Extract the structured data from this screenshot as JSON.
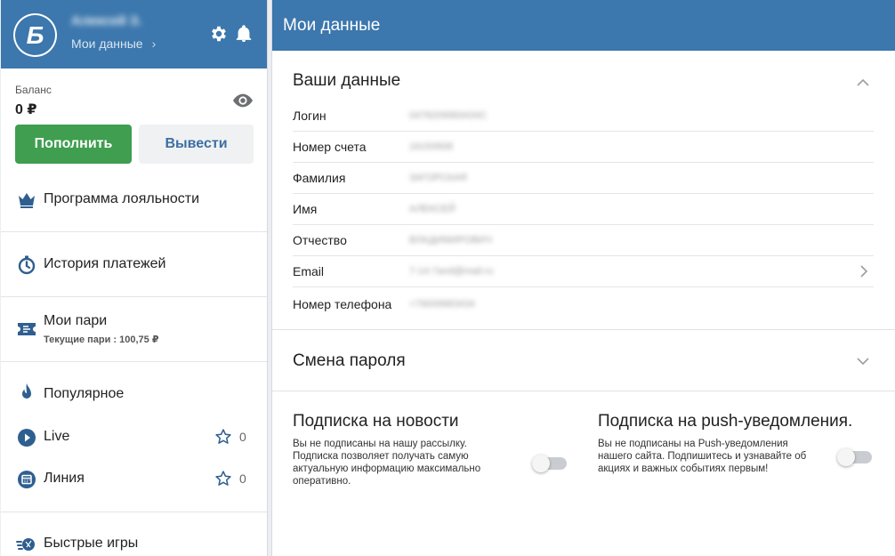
{
  "profile": {
    "logo_letter": "Б",
    "user_name": "Алексей З.",
    "my_data_link": "Мои данные",
    "link_chevron": "›"
  },
  "balance": {
    "label": "Баланс",
    "value": "0 ₽",
    "deposit_label": "Пополнить",
    "withdraw_label": "Вывести"
  },
  "menu": {
    "loyalty": "Программа лояльности",
    "payments": "История платежей",
    "my_bets": "Мои пари",
    "current_bets": "Текущие пари : 100,75 ₽",
    "popular": "Популярное",
    "live": "Live",
    "live_count": "0",
    "line": "Линия",
    "line_count": "0",
    "quick_games": "Быстрые игры"
  },
  "main": {
    "header_title": "Мои данные",
    "your_data_title": "Ваши данные",
    "fields": [
      {
        "label": "Логин",
        "value": "0478209983434C"
      },
      {
        "label": "Номер счета",
        "value": "16193908"
      },
      {
        "label": "Фамилия",
        "value": "ЗАГОРСКАЯ"
      },
      {
        "label": "Имя",
        "value": "АЛЕКСЕЙ"
      },
      {
        "label": "Отчество",
        "value": "ВЛАДИМИРОВИЧ"
      },
      {
        "label": "Email",
        "value": "7-14-7and@mail.ru"
      },
      {
        "label": "Номер телефона",
        "value": "+79009983434"
      }
    ],
    "password_title": "Смена пароля",
    "news_sub": {
      "title": "Подписка на новости",
      "desc_line1": "Вы не подписаны на нашу рассылку.",
      "desc_line2": "Подписка позволяет получать самую",
      "desc_line3": "актуальную информацию максимально",
      "desc_line4": "оперативно.",
      "enabled": false
    },
    "push_sub": {
      "title": "Подписка на push-уведомления.",
      "desc_line1": "Вы не подписаны на Push-уведомления",
      "desc_line2": "нашего сайта. Подпишитесь и узнавайте об",
      "desc_line3": "акциях и важных событиях первым!",
      "enabled": false
    }
  },
  "colors": {
    "brand_blue": "#3c77ad",
    "deposit_green": "#3f9e4f",
    "link_blue": "#3c6fa3"
  }
}
